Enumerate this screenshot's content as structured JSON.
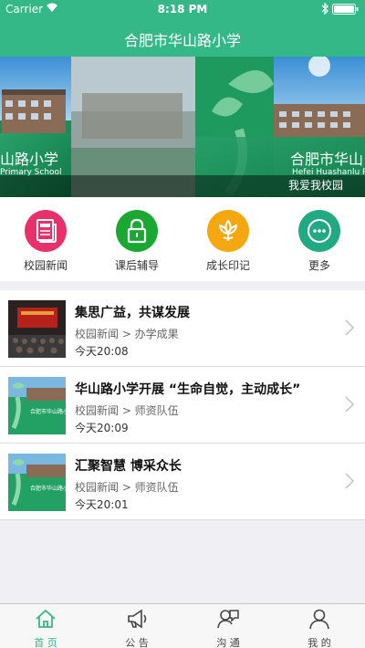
{
  "status_bar": {
    "carrier": "Carrier",
    "time": "8:18 PM"
  },
  "header": {
    "title": "合肥市华山路小学"
  },
  "banner": {
    "school_left": "山路小学",
    "school_left_en": "Primary  School",
    "school_right": "合肥市华山",
    "school_right_en": "Hefei  Huashanlu  Pri",
    "caption": "我爱我校园"
  },
  "menu": [
    {
      "label": "校园新闻",
      "icon": "newspaper-icon",
      "color": "#e8306a"
    },
    {
      "label": "课后辅导",
      "icon": "lock-icon",
      "color": "#1aa832"
    },
    {
      "label": "成长印记",
      "icon": "lotus-icon",
      "color": "#f5a70f"
    },
    {
      "label": "更多",
      "icon": "more-dots-icon",
      "color": "#20a982"
    }
  ],
  "news": [
    {
      "title": "集思广益，共谋发展",
      "category": "校园新闻 > 办学成果",
      "time": "今天20:08",
      "thumb_text": ""
    },
    {
      "title": "华山路小学开展 “生命自觉，主动成长”",
      "category": "校园新闻 > 师资队伍",
      "time": "今天20:09",
      "thumb_text": "合肥市华山路小学"
    },
    {
      "title": "汇聚智慧 博采众长",
      "category": "校园新闻 > 师资队伍",
      "time": "今天20:01",
      "thumb_text": "合肥市华山路小学"
    }
  ],
  "tabs": [
    {
      "label": "首 页",
      "icon": "home-icon",
      "active": true
    },
    {
      "label": "公 告",
      "icon": "megaphone-icon",
      "active": false
    },
    {
      "label": "沟 通",
      "icon": "chat-people-icon",
      "active": false
    },
    {
      "label": "我 的",
      "icon": "person-icon",
      "active": false
    }
  ],
  "colors": {
    "brand": "#34b887",
    "separator": "#efeff4"
  }
}
